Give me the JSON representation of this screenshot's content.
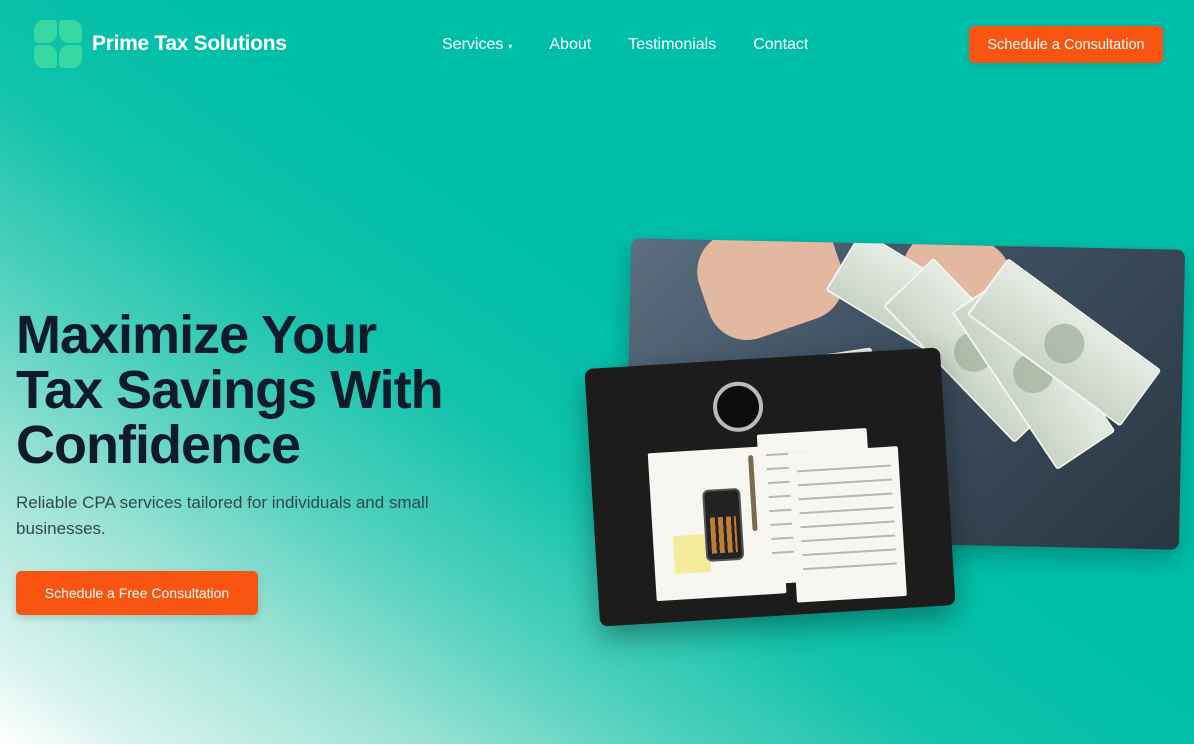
{
  "header": {
    "brand": "Prime Tax Solutions",
    "nav": [
      {
        "label": "Services",
        "has_dropdown": true
      },
      {
        "label": "About"
      },
      {
        "label": "Testimonials"
      },
      {
        "label": "Contact"
      }
    ],
    "cta_label": "Schedule a Consultation"
  },
  "hero": {
    "title_line1": "Maximize Your",
    "title_line2": "Tax Savings With",
    "title_line3": "Confidence",
    "subtitle": "Reliable CPA services tailored for individuals and small businesses.",
    "cta_label": "Schedule a Free Consultation"
  },
  "colors": {
    "background": "#00bfa9",
    "accent": "#f85412",
    "heading": "#0f1b2b",
    "logo": "#3ddba0"
  },
  "icons": {
    "caret": "chevron-down-icon"
  }
}
